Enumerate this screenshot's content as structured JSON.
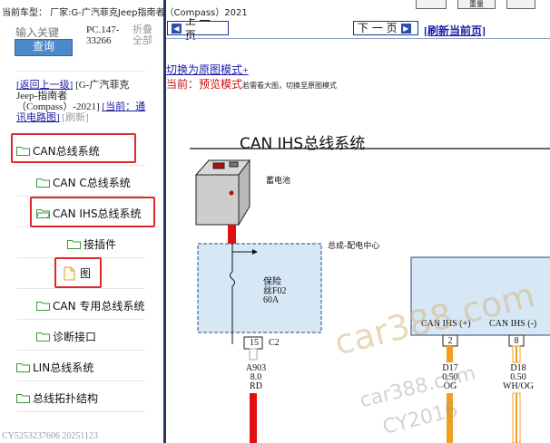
{
  "topbar": {
    "car_info": "当前车型：  厂家:G-广汽菲克Jeep指南者（Compass）2021",
    "button_left": "",
    "button_mid": "重量",
    "button_right": ""
  },
  "sidebar": {
    "search_placeholder": "输入关键",
    "search_button": "查询",
    "pc_code": "PC.147-33266",
    "collapse_all": "折叠全部",
    "back_link": "[返回上一级]",
    "vehicle_name": "[G-广汽菲克Jeep-指南者（Compass）-2021]",
    "current_prefix": "[当前：",
    "current_label": "通讯电路图]",
    "refresh_small": "[刷新]",
    "tree": {
      "can_bus": "CAN总线系统",
      "can_c": "CAN C总线系统",
      "can_ihs": "CAN IHS总线系统",
      "connector": "接插件",
      "figure": "图",
      "can_dedicated": "CAN 专用总线系统",
      "diag_port": "诊断接口",
      "lin_bus": "LIN总线系统",
      "topology": "总线拓扑结构"
    },
    "watermark": "CY5253237606 20251123"
  },
  "content": {
    "prev_button": "上 一 页",
    "next_button": "下 一 页",
    "refresh_home": "[刷新当前页]",
    "switch_mode": "切换为原图模式+",
    "current_prefix": "当前：",
    "mode_name": "预览模式",
    "mode_hint": "若需看大图，切换至原图模式"
  },
  "diagram": {
    "title": "CAN IHS总线系统",
    "battery": "蓄电池",
    "power_center": "总成-配电中心",
    "fuse_line1": "保险",
    "fuse_line2": "丝F02",
    "fuse_line3": "60A",
    "pin_num": "15",
    "connector": "C2",
    "wire_id": "A903",
    "wire_gauge": "8.0",
    "wire_color": "RD",
    "can_high": "CAN IHS (+)",
    "can_low": "CAN IHS (-)",
    "pin_high": "2",
    "pin_low": "8",
    "wire_high_id": "D17",
    "wire_high_gauge": "0.50",
    "wire_high_color": "OG",
    "wire_low_id": "D18",
    "wire_low_gauge": "0.50",
    "wire_low_color": "WH/OG"
  },
  "watermarks": {
    "w1": "car388.com",
    "w2": "car388.com",
    "w3": "CY2016"
  }
}
